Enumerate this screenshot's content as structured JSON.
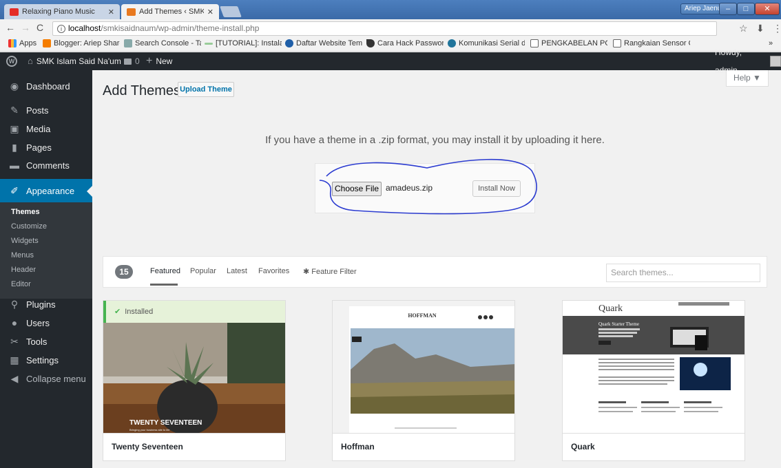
{
  "browser": {
    "tabs": [
      {
        "label": "Relaxing Piano Music"
      },
      {
        "label": "Add Themes ‹ SMK Islam"
      }
    ],
    "title_user": "Ariep Jaenul",
    "url_host": "localhost",
    "url_path": "/smkisaidnaum/wp-admin/theme-install.php",
    "bookmarks": [
      {
        "label": "Apps"
      },
      {
        "label": "Blogger: Ariep Share"
      },
      {
        "label": "Search Console - Taut"
      },
      {
        "label": "[TUTORIAL]: Instalasi"
      },
      {
        "label": "Daftar Website Temp"
      },
      {
        "label": "Cara Hack Password"
      },
      {
        "label": "Komunikasi Serial di"
      },
      {
        "label": "PENGKABELAN PORT"
      },
      {
        "label": "Rangkaian Sensor Ge"
      }
    ]
  },
  "adminbar": {
    "site_name": "SMK Islam Said Na'um",
    "comments_count": "0",
    "new_label": "New",
    "howdy": "Howdy, admin"
  },
  "sidebar": {
    "items": [
      {
        "label": "Dashboard"
      },
      {
        "label": "Posts"
      },
      {
        "label": "Media"
      },
      {
        "label": "Pages"
      },
      {
        "label": "Comments"
      },
      {
        "label": "Appearance"
      },
      {
        "label": "Plugins"
      },
      {
        "label": "Users"
      },
      {
        "label": "Tools"
      },
      {
        "label": "Settings"
      },
      {
        "label": "Collapse menu"
      }
    ],
    "submenu": [
      {
        "label": "Themes"
      },
      {
        "label": "Customize"
      },
      {
        "label": "Widgets"
      },
      {
        "label": "Menus"
      },
      {
        "label": "Header"
      },
      {
        "label": "Editor"
      }
    ]
  },
  "main": {
    "title": "Add Themes",
    "upload_button": "Upload Theme",
    "help": "Help ▼",
    "upload_text": "If you have a theme in a .zip format, you may install it by uploading it here.",
    "choose_file": "Choose File",
    "file_name": "amadeus.zip",
    "install_now": "Install Now",
    "theme_count": "15",
    "filters": [
      "Featured",
      "Popular",
      "Latest",
      "Favorites",
      "Feature Filter"
    ],
    "search_placeholder": "Search themes...",
    "installed_label": "Installed",
    "themes": [
      {
        "name": "Twenty Seventeen",
        "caption": "TWENTY SEVENTEEN",
        "tagline": "Bringing your business site to life"
      },
      {
        "name": "Hoffman",
        "caption": "HOFFMAN"
      },
      {
        "name": "Quark",
        "caption": "Quark",
        "hero_title": "Quark Starter Theme"
      }
    ]
  }
}
